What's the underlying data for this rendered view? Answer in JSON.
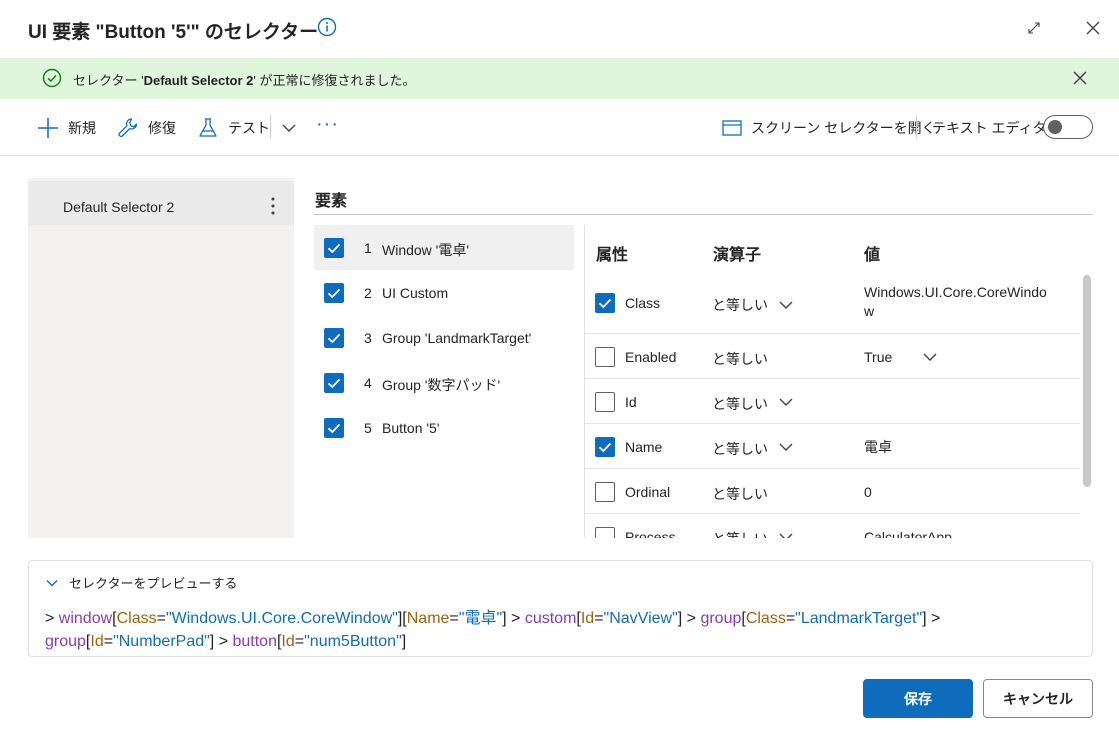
{
  "dialog": {
    "title": "UI 要素 \"Button '5'\" のセレクター"
  },
  "banner": {
    "prefix": "セレクター '",
    "selector_name": "Default Selector 2",
    "suffix": "' が正常に修復されました。"
  },
  "toolbar": {
    "new_label": "新規",
    "repair_label": "修復",
    "test_label": "テスト",
    "more_label": "···",
    "screen_selector_label": "スクリーン セレクターを開く",
    "text_editor_label": "テキスト エディター",
    "text_editor_on": false
  },
  "selectors": {
    "items": [
      {
        "label": "Default Selector 2"
      }
    ]
  },
  "elements": {
    "heading": "要素",
    "items": [
      {
        "num": "1",
        "name": "Window '電卓'",
        "checked": true,
        "selected": true
      },
      {
        "num": "2",
        "name": "UI Custom",
        "checked": true,
        "selected": false
      },
      {
        "num": "3",
        "name": "Group 'LandmarkTarget'",
        "checked": true,
        "selected": false
      },
      {
        "num": "4",
        "name": "Group '数字パッド'",
        "checked": true,
        "selected": false
      },
      {
        "num": "5",
        "name": "Button '5'",
        "checked": true,
        "selected": false
      }
    ]
  },
  "attributes": {
    "headers": {
      "attribute": "属性",
      "operator": "演算子",
      "value": "値"
    },
    "rows": [
      {
        "name": "Class",
        "checked": true,
        "operator": "と等しい",
        "value": "Windows.UI.Core.CoreWindo\nw"
      },
      {
        "name": "Enabled",
        "checked": false,
        "operator": "と等しい",
        "value": "True"
      },
      {
        "name": "Id",
        "checked": false,
        "operator": "と等しい",
        "value": ""
      },
      {
        "name": "Name",
        "checked": true,
        "operator": "と等しい",
        "value": "電卓"
      },
      {
        "name": "Ordinal",
        "checked": false,
        "operator": "と等しい",
        "value": "0"
      },
      {
        "name": "Process",
        "checked": false,
        "operator": "と等しい",
        "value": "CalculatorApp"
      }
    ]
  },
  "preview": {
    "toggle_label": "セレクターをプレビューする",
    "tokens": [
      {
        "t": "> ",
        "c": "plain"
      },
      {
        "t": "window",
        "c": "kw"
      },
      {
        "t": "[",
        "c": "plain"
      },
      {
        "t": "Class",
        "c": "attr"
      },
      {
        "t": "=",
        "c": "plain"
      },
      {
        "t": "\"Windows.UI.Core.CoreWindow\"",
        "c": "val"
      },
      {
        "t": "][",
        "c": "plain"
      },
      {
        "t": "Name",
        "c": "attr"
      },
      {
        "t": "=",
        "c": "plain"
      },
      {
        "t": "\"電卓\"",
        "c": "val"
      },
      {
        "t": "] > ",
        "c": "plain"
      },
      {
        "t": "custom",
        "c": "kw"
      },
      {
        "t": "[",
        "c": "plain"
      },
      {
        "t": "Id",
        "c": "attr"
      },
      {
        "t": "=",
        "c": "plain"
      },
      {
        "t": "\"NavView\"",
        "c": "val"
      },
      {
        "t": "] > ",
        "c": "plain"
      },
      {
        "t": "group",
        "c": "kw"
      },
      {
        "t": "[",
        "c": "plain"
      },
      {
        "t": "Class",
        "c": "attr"
      },
      {
        "t": "=",
        "c": "plain"
      },
      {
        "t": "\"LandmarkTarget\"",
        "c": "val"
      },
      {
        "t": "] > ",
        "c": "plain"
      },
      {
        "t": "group",
        "c": "kw"
      },
      {
        "t": "[",
        "c": "plain"
      },
      {
        "t": "Id",
        "c": "attr"
      },
      {
        "t": "=",
        "c": "plain"
      },
      {
        "t": "\"NumberPad\"",
        "c": "val"
      },
      {
        "t": "] > ",
        "c": "plain"
      },
      {
        "t": "button",
        "c": "kw"
      },
      {
        "t": "[",
        "c": "plain"
      },
      {
        "t": "Id",
        "c": "attr"
      },
      {
        "t": "=",
        "c": "plain"
      },
      {
        "t": "\"num5Button\"",
        "c": "val"
      },
      {
        "t": "]",
        "c": "plain"
      }
    ]
  },
  "footer": {
    "save_label": "保存",
    "cancel_label": "キャンセル"
  },
  "colors": {
    "accent": "#0f6cbd",
    "success_bg": "#dff6dd",
    "success_icon": "#107c10",
    "keyword": "#8a3ab9",
    "attribute": "#a0620e",
    "value": "#0f6cbd"
  }
}
